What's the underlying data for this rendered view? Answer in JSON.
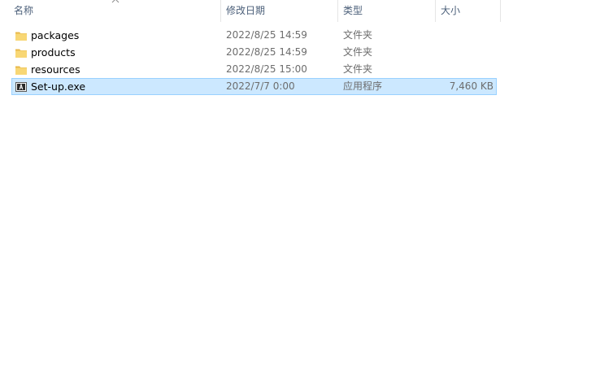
{
  "columns": {
    "name": "名称",
    "modified": "修改日期",
    "type": "类型",
    "size": "大小"
  },
  "sort": {
    "column": "name",
    "icon": "chevron-up-icon"
  },
  "colors": {
    "folder": "#f8d775",
    "selection_bg": "#cce8ff",
    "selection_border": "#99d1ff",
    "header_text": "#4c607a"
  },
  "files": [
    {
      "name": "packages",
      "modified": "2022/8/25 14:59",
      "type": "文件夹",
      "size": "",
      "icon": "folder-icon"
    },
    {
      "name": "products",
      "modified": "2022/8/25 14:59",
      "type": "文件夹",
      "size": "",
      "icon": "folder-icon"
    },
    {
      "name": "resources",
      "modified": "2022/8/25 15:00",
      "type": "文件夹",
      "size": "",
      "icon": "folder-icon"
    },
    {
      "name": "Set-up.exe",
      "modified": "2022/7/7 0:00",
      "type": "应用程序",
      "size": "7,460 KB",
      "icon": "adobe-app-icon",
      "selected": true
    }
  ]
}
